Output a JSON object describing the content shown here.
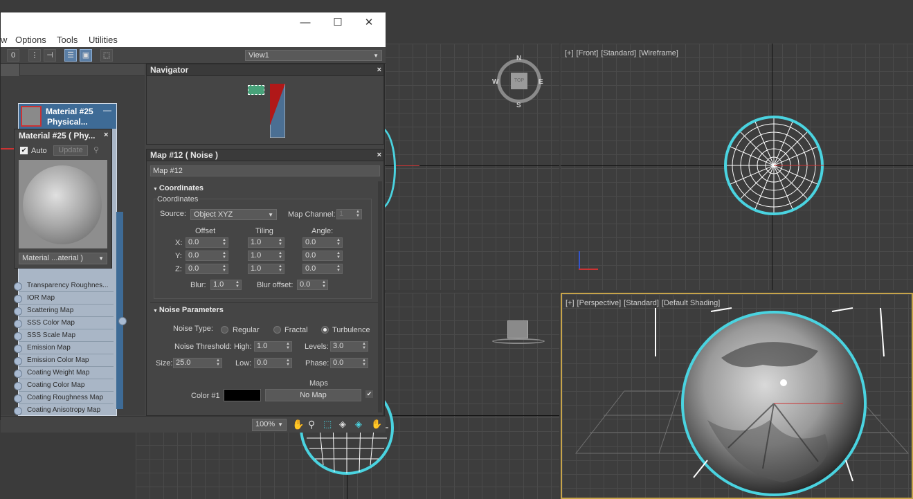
{
  "menu": [
    "w",
    "Options",
    "Tools",
    "Utilities"
  ],
  "window_controls": {
    "minimize": "—",
    "maximize": "☐",
    "close": "✕"
  },
  "toolbar": {
    "view_dropdown": "View1",
    "zero_btn": "0"
  },
  "navigator": {
    "title": "Navigator",
    "close": "×"
  },
  "material_node": {
    "name": "Material #25",
    "type": "Physical..."
  },
  "preview": {
    "title": "Material #25  ( Phy...",
    "close": "×",
    "auto_label": "Auto",
    "update_label": "Update",
    "dropdown": "Material ...aterial )"
  },
  "slots": [
    "Transparency Roughnes...",
    "IOR Map",
    "Scattering Map",
    "SSS Color Map",
    "SSS Scale Map",
    "Emission Map",
    "Emission Color Map",
    "Coating Weight Map",
    "Coating Color Map",
    "Coating Roughness Map",
    "Coating Anisotropy Map"
  ],
  "map_panel": {
    "title": "Map #12  ( Noise )",
    "close": "×",
    "name": "Map #12",
    "coordinates": {
      "rollout": "Coordinates",
      "group": "Coordinates",
      "source_label": "Source:",
      "source_value": "Object XYZ",
      "map_channel_label": "Map Channel:",
      "map_channel_value": "1",
      "offset_label": "Offset",
      "tiling_label": "Tiling",
      "angle_label": "Angle:",
      "x_label": "X:",
      "y_label": "Y:",
      "z_label": "Z:",
      "offset": [
        "0.0",
        "0.0",
        "0.0"
      ],
      "tiling": [
        "1.0",
        "1.0",
        "1.0"
      ],
      "angle": [
        "0.0",
        "0.0",
        "0.0"
      ],
      "blur_label": "Blur:",
      "blur_value": "1.0",
      "blur_offset_label": "Blur offset:",
      "blur_offset_value": "0.0"
    },
    "noise": {
      "rollout": "Noise Parameters",
      "type_label": "Noise Type:",
      "types": [
        "Regular",
        "Fractal",
        "Turbulence"
      ],
      "selected_type": "Turbulence",
      "threshold_label": "Noise Threshold:",
      "high_label": "High:",
      "high_value": "1.0",
      "levels_label": "Levels:",
      "levels_value": "3.0",
      "size_label": "Size:",
      "size_value": "25.0",
      "low_label": "Low:",
      "low_value": "0.0",
      "phase_label": "Phase:",
      "phase_value": "0.0",
      "maps_label": "Maps",
      "color1_label": "Color #1",
      "color1_map": "No Map"
    }
  },
  "zoom": {
    "value": "100%"
  },
  "viewports": {
    "front": [
      "[+]",
      "[Front]",
      "[Standard]",
      "[Wireframe]"
    ],
    "perspective": [
      "[+]",
      "[Perspective]",
      "[Standard]",
      "[Default Shading]"
    ],
    "viewcube_top": "TOP",
    "compass": {
      "n": "N",
      "s": "S",
      "e": "E",
      "w": "W"
    }
  },
  "colors": {
    "accent": "#4ad3e0",
    "material_header": "#3e6b96",
    "noise_color1": "#000000"
  }
}
